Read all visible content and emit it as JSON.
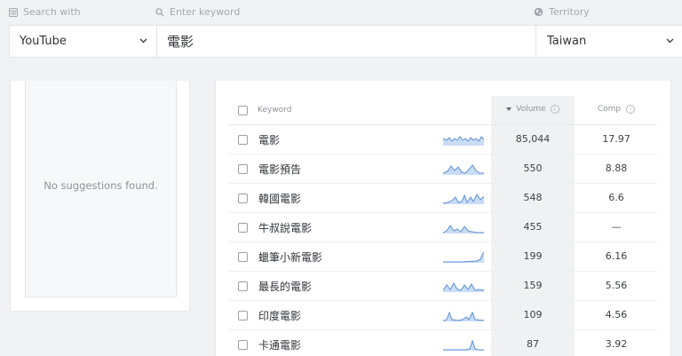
{
  "labels": {
    "search_with": "Search with",
    "enter_keyword": "Enter keyword",
    "territory": "Territory"
  },
  "search": {
    "platform": "YouTube",
    "keyword": "電影",
    "territory": "Taiwan"
  },
  "suggestions": {
    "empty_text": "No suggestions found."
  },
  "table": {
    "headers": {
      "keyword": "Keyword",
      "volume": "Volume",
      "comp": "Comp"
    },
    "rows": [
      {
        "keyword": "電影",
        "volume": "85,044",
        "comp": "17.97"
      },
      {
        "keyword": "電影預告",
        "volume": "550",
        "comp": "8.88"
      },
      {
        "keyword": "韓國電影",
        "volume": "548",
        "comp": "6.6"
      },
      {
        "keyword": "牛叔說電影",
        "volume": "455",
        "comp": "—"
      },
      {
        "keyword": "蠟筆小新電影",
        "volume": "199",
        "comp": "6.16"
      },
      {
        "keyword": "最長的電影",
        "volume": "159",
        "comp": "5.56"
      },
      {
        "keyword": "印度電影",
        "volume": "109",
        "comp": "4.56"
      },
      {
        "keyword": "卡通電影",
        "volume": "87",
        "comp": "3.92"
      }
    ]
  },
  "colors": {
    "sparkline_stroke": "#5b8fd6",
    "sparkline_fill": "#c9dcf5"
  },
  "icons": {
    "search_with": "window-icon",
    "enter_keyword": "search-icon",
    "territory": "globe-icon",
    "dropdown": "chevron-down-icon",
    "sort": "sort-down-icon",
    "info": "info-icon"
  }
}
